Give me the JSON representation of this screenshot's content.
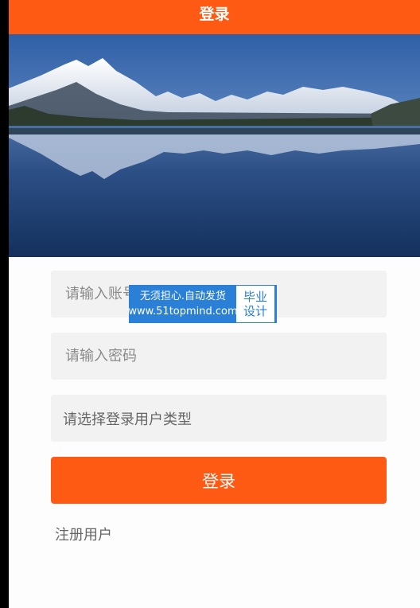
{
  "header": {
    "title": "登录"
  },
  "hero": {
    "image": "mountain-lake-reflection"
  },
  "form": {
    "account_placeholder": "请输入账号",
    "password_placeholder": "请输入密码",
    "user_type_select": "请选择登录用户类型",
    "login_button": "登录",
    "register_link": "注册用户"
  },
  "watermark": {
    "line1": "无须担心.自动发货",
    "line2": "www.51topmind.com",
    "right_line1": "毕业",
    "right_line2": "设计"
  },
  "colors": {
    "accent": "#ff5a14",
    "field_bg": "#f2f2f2",
    "watermark_blue": "#2a7fd6"
  }
}
